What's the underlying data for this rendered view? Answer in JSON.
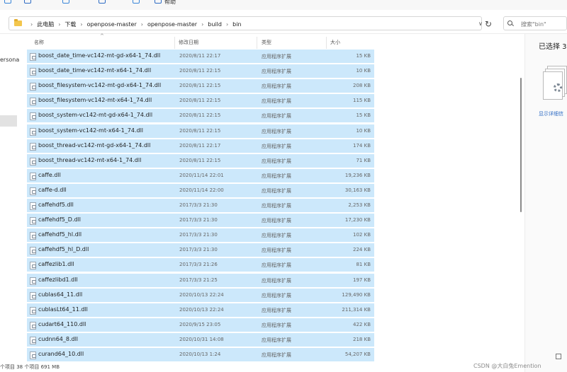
{
  "address_bar": {
    "breadcrumbs": [
      "此电脑",
      "下载",
      "openpose-master",
      "openpose-master",
      "build",
      "bin"
    ],
    "search_placeholder": "搜索\"bin\""
  },
  "toolbar": {
    "partial_text": "帮助"
  },
  "nav_pane": {
    "partial_item": "ersona"
  },
  "columns": {
    "name": "名称",
    "date": "修改日期",
    "type": "类型",
    "size": "大小"
  },
  "files": [
    {
      "name": "boost_date_time-vc142-mt-gd-x64-1_74.dll",
      "date": "2020/8/11 22:17",
      "type": "应用程序扩展",
      "size": "15 KB"
    },
    {
      "name": "boost_date_time-vc142-mt-x64-1_74.dll",
      "date": "2020/8/11 22:15",
      "type": "应用程序扩展",
      "size": "10 KB"
    },
    {
      "name": "boost_filesystem-vc142-mt-gd-x64-1_74.dll",
      "date": "2020/8/11 22:15",
      "type": "应用程序扩展",
      "size": "208 KB"
    },
    {
      "name": "boost_filesystem-vc142-mt-x64-1_74.dll",
      "date": "2020/8/11 22:15",
      "type": "应用程序扩展",
      "size": "115 KB"
    },
    {
      "name": "boost_system-vc142-mt-gd-x64-1_74.dll",
      "date": "2020/8/11 22:15",
      "type": "应用程序扩展",
      "size": "15 KB"
    },
    {
      "name": "boost_system-vc142-mt-x64-1_74.dll",
      "date": "2020/8/11 22:15",
      "type": "应用程序扩展",
      "size": "10 KB"
    },
    {
      "name": "boost_thread-vc142-mt-gd-x64-1_74.dll",
      "date": "2020/8/11 22:17",
      "type": "应用程序扩展",
      "size": "174 KB"
    },
    {
      "name": "boost_thread-vc142-mt-x64-1_74.dll",
      "date": "2020/8/11 22:15",
      "type": "应用程序扩展",
      "size": "71 KB"
    },
    {
      "name": "caffe.dll",
      "date": "2020/11/14 22:01",
      "type": "应用程序扩展",
      "size": "19,236 KB"
    },
    {
      "name": "caffe-d.dll",
      "date": "2020/11/14 22:00",
      "type": "应用程序扩展",
      "size": "30,163 KB"
    },
    {
      "name": "caffehdf5.dll",
      "date": "2017/3/3 21:30",
      "type": "应用程序扩展",
      "size": "2,253 KB"
    },
    {
      "name": "caffehdf5_D.dll",
      "date": "2017/3/3 21:30",
      "type": "应用程序扩展",
      "size": "17,230 KB"
    },
    {
      "name": "caffehdf5_hl.dll",
      "date": "2017/3/3 21:30",
      "type": "应用程序扩展",
      "size": "102 KB"
    },
    {
      "name": "caffehdf5_hl_D.dll",
      "date": "2017/3/3 21:30",
      "type": "应用程序扩展",
      "size": "224 KB"
    },
    {
      "name": "caffezlib1.dll",
      "date": "2017/3/3 21:26",
      "type": "应用程序扩展",
      "size": "81 KB"
    },
    {
      "name": "caffezlibd1.dll",
      "date": "2017/3/3 21:25",
      "type": "应用程序扩展",
      "size": "197 KB"
    },
    {
      "name": "cublas64_11.dll",
      "date": "2020/10/13 22:24",
      "type": "应用程序扩展",
      "size": "129,490 KB"
    },
    {
      "name": "cublasLt64_11.dll",
      "date": "2020/10/13 22:24",
      "type": "应用程序扩展",
      "size": "211,314 KB"
    },
    {
      "name": "cudart64_110.dll",
      "date": "2020/9/15 23:05",
      "type": "应用程序扩展",
      "size": "422 KB"
    },
    {
      "name": "cudnn64_8.dll",
      "date": "2020/10/31 14:08",
      "type": "应用程序扩展",
      "size": "218 KB"
    },
    {
      "name": "curand64_10.dll",
      "date": "2020/10/13 1:24",
      "type": "应用程序扩展",
      "size": "54,207 KB"
    }
  ],
  "details_pane": {
    "selected_label": "已选择 3",
    "show_details_link": "显示详细信"
  },
  "status_bar": {
    "text": "个项目 38 个项目 691 MB"
  },
  "watermark": "CSDN @大白兔Emention",
  "colors": {
    "selection": "#cce8fb",
    "accent": "#2f6cc4"
  }
}
